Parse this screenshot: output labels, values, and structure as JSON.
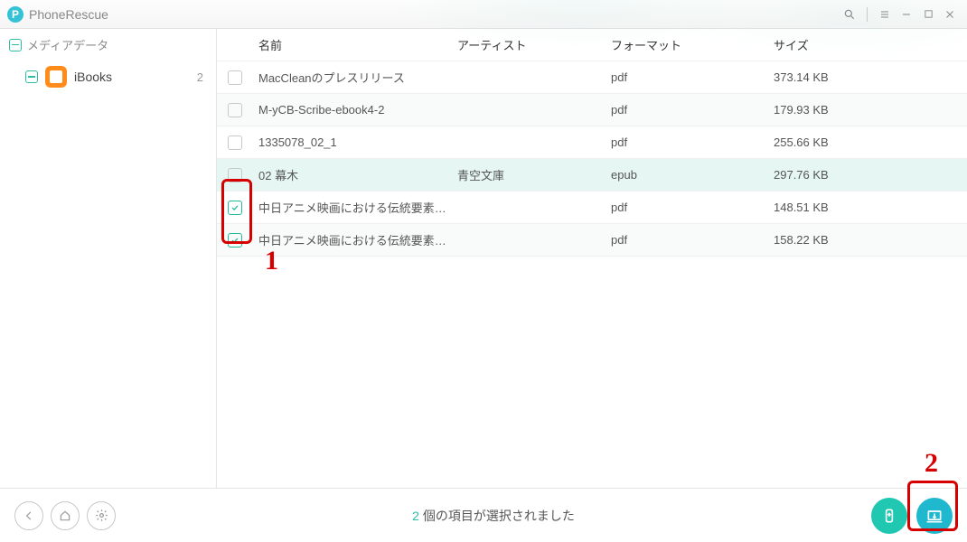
{
  "app": {
    "name": "PhoneRescue"
  },
  "sidebar": {
    "group_label": "メディアデータ",
    "items": [
      {
        "label": "iBooks",
        "count": "2"
      }
    ]
  },
  "table": {
    "headers": {
      "name": "名前",
      "artist": "アーティスト",
      "format": "フォーマット",
      "size": "サイズ"
    },
    "rows": [
      {
        "checked": false,
        "name": "MacCleanのプレスリリース",
        "artist": "",
        "format": "pdf",
        "size": "373.14 KB"
      },
      {
        "checked": false,
        "name": "M-yCB-Scribe-ebook4-2",
        "artist": "",
        "format": "pdf",
        "size": "179.93 KB"
      },
      {
        "checked": false,
        "name": "1335078_02_1",
        "artist": "",
        "format": "pdf",
        "size": "255.66 KB"
      },
      {
        "checked": false,
        "name": "02 幕木",
        "artist": "青空文庫",
        "format": "epub",
        "size": "297.76 KB"
      },
      {
        "checked": true,
        "name": "中日アニメ映画における伝統要素について —『...",
        "artist": "",
        "format": "pdf",
        "size": "148.51 KB"
      },
      {
        "checked": true,
        "name": "中日アニメ映画における伝統要素について —『...",
        "artist": "",
        "format": "pdf",
        "size": "158.22 KB"
      }
    ]
  },
  "footer": {
    "selected_count": "2",
    "status_suffix": " 個の項目が選択されました"
  },
  "annotations": {
    "label1": "1",
    "label2": "2"
  }
}
